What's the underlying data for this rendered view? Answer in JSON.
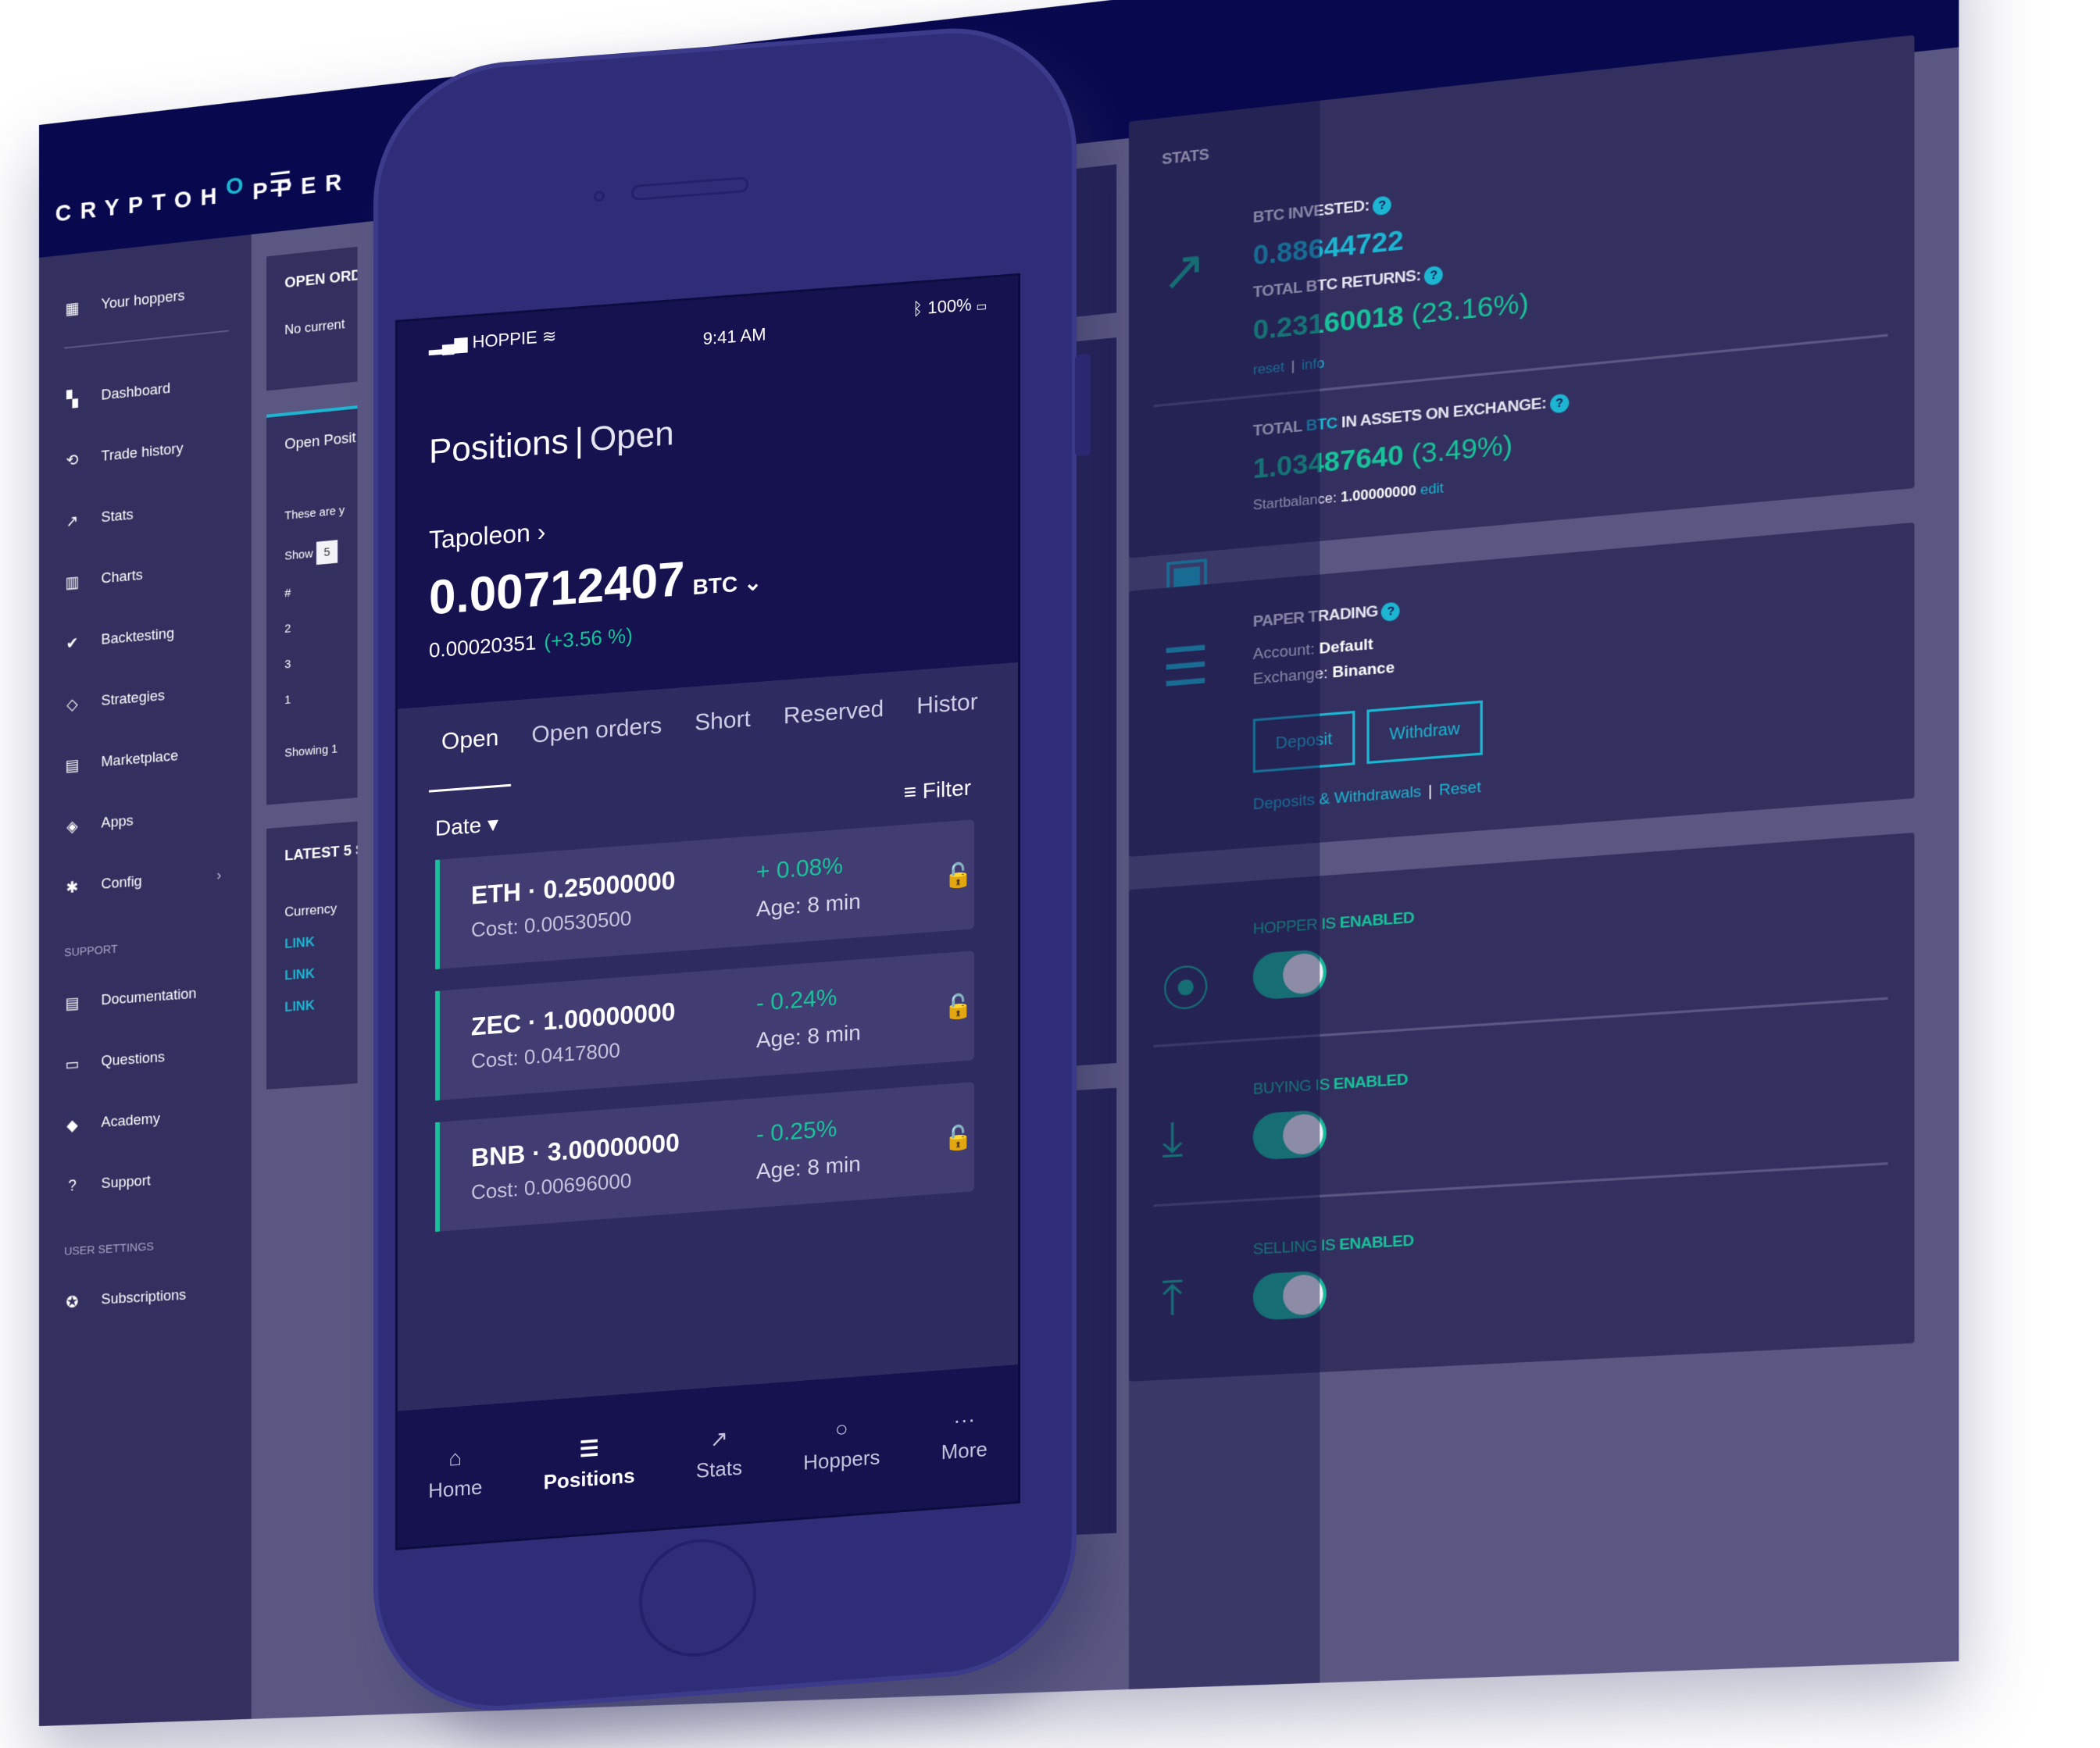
{
  "desktop": {
    "logo": {
      "text_before": "CRYPTOH",
      "accent_letter": "O",
      "text_after": "PPER"
    },
    "menu_icon": "hamburger-icon",
    "top_icons": [
      {
        "name": "moon-icon",
        "glyph": "☾"
      },
      {
        "name": "chat-icon",
        "glyph": "💬"
      },
      {
        "name": "user-icon",
        "glyph": "👤"
      }
    ],
    "sidebar": {
      "top_item": {
        "label": "Your hoppers",
        "icon": "▦"
      },
      "items": [
        {
          "label": "Dashboard",
          "icon": "▚"
        },
        {
          "label": "Trade history",
          "icon": "⟲"
        },
        {
          "label": "Stats",
          "icon": "↗"
        },
        {
          "label": "Charts",
          "icon": "▥"
        },
        {
          "label": "Backtesting",
          "icon": "✔"
        },
        {
          "label": "Strategies",
          "icon": "◇"
        },
        {
          "label": "Marketplace",
          "icon": "▤"
        },
        {
          "label": "Apps",
          "icon": "◈"
        },
        {
          "label": "Config",
          "icon": "✱",
          "chevron": "›"
        }
      ],
      "support_heading": "SUPPORT",
      "support_items": [
        {
          "label": "Documentation",
          "icon": "▤"
        },
        {
          "label": "Questions",
          "icon": "▭"
        },
        {
          "label": "Academy",
          "icon": "◆"
        },
        {
          "label": "Support",
          "icon": "?"
        }
      ],
      "user_settings_heading": "USER SETTINGS",
      "user_items": [
        {
          "label": "Subscriptions",
          "icon": "✪"
        }
      ]
    },
    "middle": {
      "open_orders": {
        "title": "OPEN ORD",
        "text": "No current"
      },
      "open_positions": {
        "title": "Open Posit",
        "text": "These are y",
        "show_label": "Show",
        "show_value": "5",
        "col_header": "#",
        "rows": [
          "2",
          "3",
          "1"
        ],
        "footer": "Showing 1"
      },
      "latest": {
        "title": "LATEST 5 S",
        "col_header": "Currency",
        "rows": [
          "LINK",
          "LINK",
          "LINK"
        ]
      }
    },
    "stats": {
      "title": "STATS",
      "minimize": "–",
      "close": "✕",
      "btc_invested_label": "BTC INVESTED:",
      "btc_invested_value": "0.88644722",
      "total_returns_label": "TOTAL BTC RETURNS:",
      "total_returns_value": "0.23160018",
      "total_returns_pct": "(23.16%)",
      "reset_link": "reset",
      "info_link": "info",
      "assets_label_pre": "TOTAL",
      "assets_label_btc": "BTC",
      "assets_label_post": "IN ASSETS ON EXCHANGE:",
      "assets_value": "1.03487640",
      "assets_pct": "(3.49%)",
      "startbalance_label": "Startbalance:",
      "startbalance_value": "1.00000000",
      "edit_link": "edit"
    },
    "paper_trading": {
      "title": "PAPER TRADING",
      "account_label": "Account:",
      "account_value": "Default",
      "exchange_label": "Exchange:",
      "exchange_value": "Binance",
      "deposit_button": "Deposit",
      "withdraw_button": "Withdraw",
      "deposits_link": "Deposits & Withdrawals",
      "reset_link": "Reset"
    },
    "toggles": [
      {
        "label_pre": "HOPPER IS",
        "label_state": "ENABLED",
        "icon": "traffic-light-icon",
        "glyph": "🚦",
        "on": true
      },
      {
        "label_pre": "BUYING IS",
        "label_state": "ENABLED",
        "icon": "download-icon",
        "glyph": "⤓",
        "on": true
      },
      {
        "label_pre": "SELLING IS",
        "label_state": "ENABLED",
        "icon": "upload-icon",
        "glyph": "⤒",
        "on": true
      }
    ],
    "help_glyph": "?"
  },
  "phone": {
    "status": {
      "carrier": "HOPPIE",
      "time": "9:41 AM",
      "battery": "100%"
    },
    "title": "Positions",
    "subtitle": "Open",
    "hopper_name": "Tapoleon",
    "balance": "0.00712407",
    "currency": "BTC",
    "delta_value": "0.00020351",
    "delta_pct": "(+3.56 %)",
    "tabs": [
      "Open",
      "Open orders",
      "Short",
      "Reserved",
      "Histor"
    ],
    "active_tab": 0,
    "sort_label": "Date",
    "filter_label": "Filter",
    "positions": [
      {
        "name": "ETH · 0.25000000",
        "cost": "Cost: 0.00530500",
        "change": "+ 0.08%",
        "age": "Age: 8 min"
      },
      {
        "name": "ZEC · 1.00000000",
        "cost": "Cost: 0.0417800",
        "change": "- 0.24%",
        "age": "Age: 8 min"
      },
      {
        "name": "BNB · 3.00000000",
        "cost": "Cost: 0.00696000",
        "change": "- 0.25%",
        "age": "Age: 8 min"
      }
    ],
    "tabbar": [
      {
        "label": "Home",
        "icon": "⌂"
      },
      {
        "label": "Positions",
        "icon": "☰"
      },
      {
        "label": "Stats",
        "icon": "↗"
      },
      {
        "label": "Hoppers",
        "icon": "○"
      },
      {
        "label": "More",
        "icon": "···"
      }
    ],
    "active_tabbar": 1
  },
  "colors": {
    "accent_teal": "#1cb6d2",
    "accent_green": "#19c29a",
    "navy": "#08084f",
    "panel": "#33305f"
  }
}
